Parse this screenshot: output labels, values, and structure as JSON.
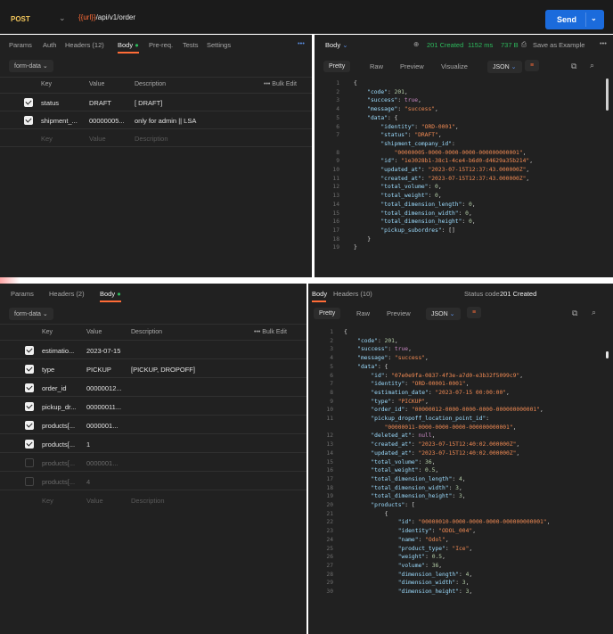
{
  "top": {
    "method": "POST",
    "url_var": "{{url}}",
    "url_path": "/api/v1/order",
    "send": "Send"
  },
  "req1": {
    "tabs": [
      "Params",
      "Auth",
      "Headers (12)",
      "Body",
      "Pre-req.",
      "Tests",
      "Settings"
    ],
    "body_type": "form-data",
    "bulk_edit": "Bulk Edit",
    "cols": [
      "Key",
      "Value",
      "Description"
    ],
    "rows": [
      {
        "key": "status",
        "value": "DRAFT",
        "desc": "[ DRAFT]"
      },
      {
        "key": "shipment_...",
        "value": "00000005...",
        "desc": "only for admin || LSA"
      }
    ],
    "ph": {
      "key": "Key",
      "value": "Value",
      "desc": "Description"
    }
  },
  "res1": {
    "label": "Body",
    "status": "201 Created",
    "time": "1152 ms",
    "size": "737 B",
    "save": "Save as Example",
    "views": [
      "Pretty",
      "Raw",
      "Preview",
      "Visualize"
    ],
    "format": "JSON"
  },
  "req2": {
    "tabs": [
      "Params",
      "Headers (2)",
      "Body"
    ],
    "body_type": "form-data",
    "bulk_edit": "Bulk Edit",
    "cols": [
      "Key",
      "Value",
      "Description"
    ],
    "rows": [
      {
        "key": "estimatio...",
        "value": "2023-07-15",
        "desc": "",
        "on": true
      },
      {
        "key": "type",
        "value": "PICKUP",
        "desc": "[PICKUP, DROPOFF]",
        "on": true
      },
      {
        "key": "order_id",
        "value": "00000012...",
        "desc": "",
        "on": true
      },
      {
        "key": "pickup_dr...",
        "value": "00000011...",
        "desc": "",
        "on": true
      },
      {
        "key": "products[...",
        "value": "0000001...",
        "desc": "",
        "on": true
      },
      {
        "key": "products[...",
        "value": "1",
        "desc": "",
        "on": true
      },
      {
        "key": "products[...",
        "value": "0000001...",
        "desc": "",
        "on": false
      },
      {
        "key": "products[...",
        "value": "4",
        "desc": "",
        "on": false
      }
    ],
    "ph": {
      "key": "Key",
      "value": "Value",
      "desc": "Description"
    }
  },
  "res2": {
    "tabs": [
      "Body",
      "Headers (10)"
    ],
    "status_label": "Status code",
    "status": "201 Created",
    "views": [
      "Pretty",
      "Raw",
      "Preview"
    ],
    "format": "JSON"
  },
  "code1": [
    "{",
    "    \"code\": 201,",
    "    \"success\": true,",
    "    \"message\": \"success\",",
    "    \"data\": {",
    "        \"identity\": \"ORD-0001\",",
    "        \"status\": \"DRAFT\",",
    "        \"shipment_company_id\":",
    "            \"00000005-0000-0000-0000-000000000001\",",
    "        \"id\": \"1e3028b1-38c1-4ce4-b6d0-d4629a35b214\",",
    "        \"updated_at\": \"2023-07-15T12:37:43.000000Z\",",
    "        \"created_at\": \"2023-07-15T12:37:43.000000Z\",",
    "        \"total_volume\": 0,",
    "        \"total_weight\": 0,",
    "        \"total_dimension_length\": 0,",
    "        \"total_dimension_width\": 0,",
    "        \"total_dimension_height\": 0,",
    "        \"pickup_subordres\": []",
    "    }",
    "}"
  ],
  "code1_ln": [
    "1",
    "2",
    "3",
    "4",
    "5",
    "6",
    "7",
    "",
    "8",
    "9",
    "10",
    "11",
    "12",
    "13",
    "14",
    "15",
    "16",
    "17",
    "18",
    "19"
  ],
  "code2": [
    "{",
    "    \"code\": 201,",
    "    \"success\": true,",
    "    \"message\": \"success\",",
    "    \"data\": {",
    "        \"id\": \"07e0e9fa-0837-4f3e-a7d0-e3b32f5099c9\",",
    "        \"identity\": \"ORD-00001-0001\",",
    "        \"estimation_date\": \"2023-07-15 00:00:00\",",
    "        \"type\": \"PICKUP\",",
    "        \"order_id\": \"00000012-0000-0000-0000-000000000001\",",
    "        \"pickup_dropoff_location_point_id\":",
    "            \"00000011-0000-0000-0000-000000000001\",",
    "        \"deleted_at\": null,",
    "        \"created_at\": \"2023-07-15T12:40:02.000000Z\",",
    "        \"updated_at\": \"2023-07-15T12:40:02.000000Z\",",
    "        \"total_volume\": 36,",
    "        \"total_weight\": 0.5,",
    "        \"total_dimension_length\": 4,",
    "        \"total_dimension_width\": 3,",
    "        \"total_dimension_height\": 3,",
    "        \"products\": [",
    "            {",
    "                \"id\": \"00000010-0000-0000-0000-000000000001\",",
    "                \"identity\": \"ODOL_004\",",
    "                \"name\": \"Odol\",",
    "                \"product_type\": \"Ice\",",
    "                \"weight\": 0.5,",
    "                \"volume\": 36,",
    "                \"dimension_length\": 4,",
    "                \"dimension_width\": 3,",
    "                \"dimension_height\": 3,"
  ],
  "code2_ln": [
    "1",
    "2",
    "3",
    "4",
    "5",
    "6",
    "7",
    "8",
    "9",
    "10",
    "11",
    "",
    "12",
    "13",
    "14",
    "15",
    "16",
    "17",
    "18",
    "19",
    "20",
    "21",
    "22",
    "23",
    "24",
    "25",
    "26",
    "27",
    "28",
    "29",
    "30"
  ]
}
